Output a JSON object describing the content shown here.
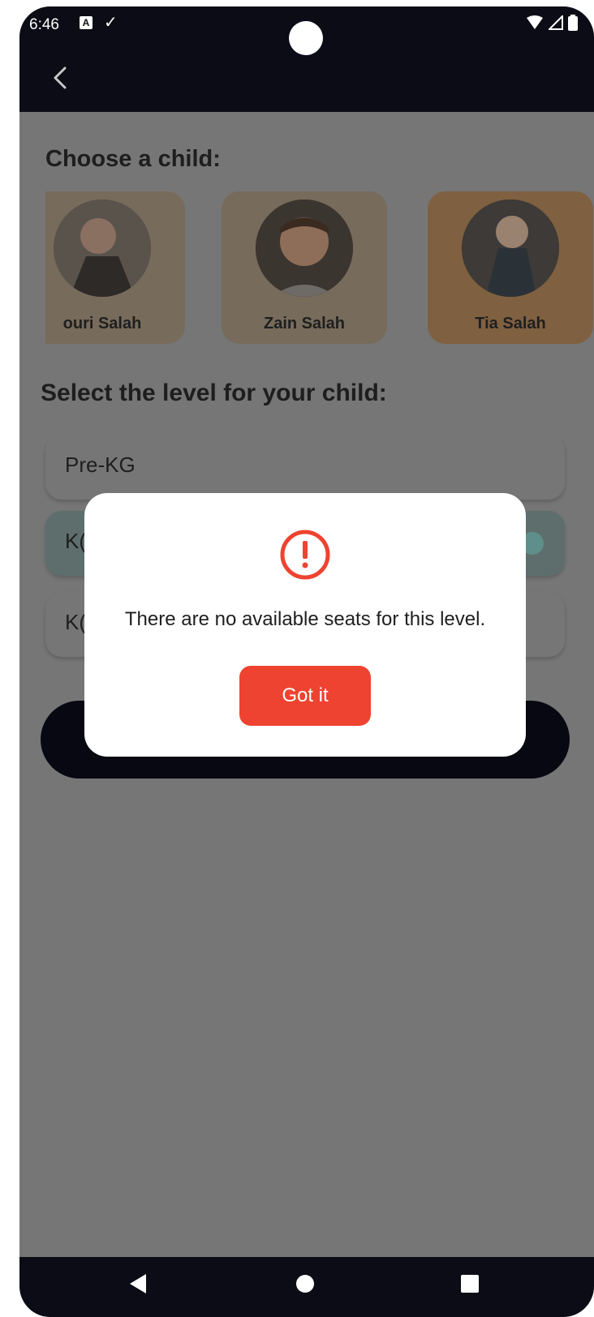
{
  "status_bar": {
    "time": "6:46"
  },
  "headings": {
    "choose_child": "Choose a child:",
    "select_level": "Select the level for your child:"
  },
  "children": [
    {
      "name": "Nouri Salah",
      "visible_name": "ouri Salah",
      "selected": false
    },
    {
      "name": "Zain Salah",
      "visible_name": "Zain Salah",
      "selected": false
    },
    {
      "name": "Tia Salah",
      "visible_name": "Tia Salah",
      "selected": true
    }
  ],
  "levels": [
    {
      "label": "Pre-KG",
      "selected": false
    },
    {
      "label": "KG",
      "visible_label": "K(",
      "selected": true
    },
    {
      "label": "KG",
      "visible_label": "K(",
      "selected": false
    }
  ],
  "dialog": {
    "icon": "alert-circle-icon",
    "message": "There are no available seats for this level.",
    "button_label": "Got it"
  },
  "colors": {
    "accent": "#ee4330",
    "dark": "#0b0c16",
    "overlay": "#767676",
    "selected_card": "#7f6040"
  }
}
